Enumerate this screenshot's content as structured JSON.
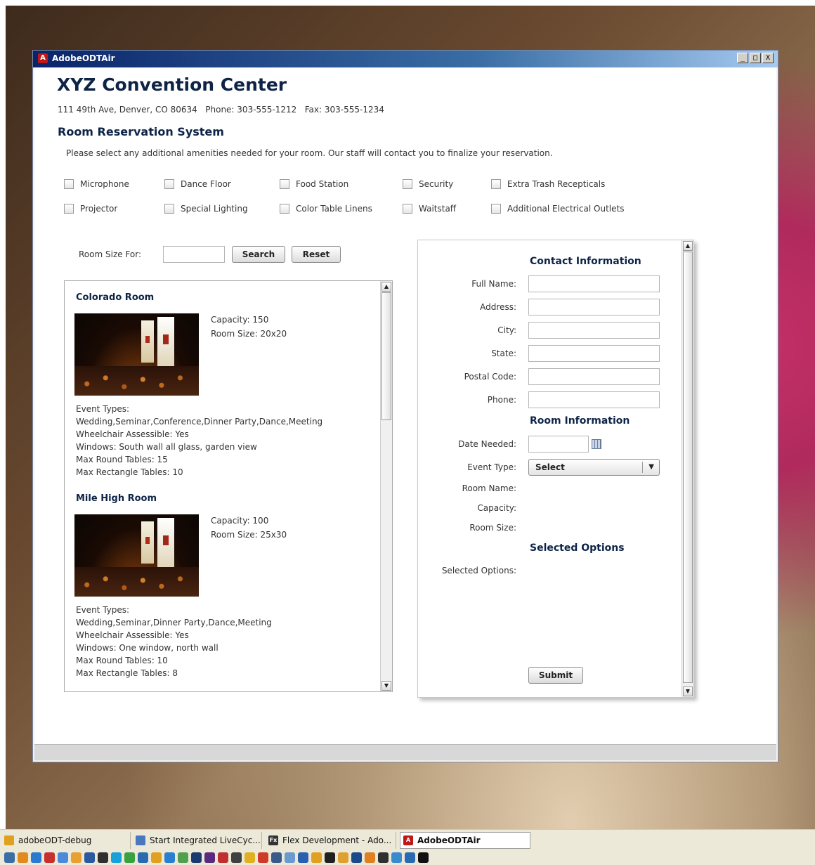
{
  "window": {
    "title": "AdobeODTAir",
    "minimize": "_",
    "maximize": "□",
    "close": "X"
  },
  "header": {
    "title": "XYZ Convention Center",
    "address": "111 49th Ave, Denver, CO 80634   Phone: 303-555-1212   Fax: 303-555-1234",
    "subtitle": "Room Reservation System",
    "intro": "Please select any additional amenities needed for your room. Our staff will contact you to finalize your reservation."
  },
  "amenities": [
    {
      "label": "Microphone",
      "checked": false
    },
    {
      "label": "Dance Floor",
      "checked": false
    },
    {
      "label": "Food Station",
      "checked": false
    },
    {
      "label": "Security",
      "checked": false
    },
    {
      "label": "Extra Trash Recepticals",
      "checked": false
    },
    {
      "label": "Projector",
      "checked": false
    },
    {
      "label": "Special Lighting",
      "checked": false
    },
    {
      "label": "Color Table Linens",
      "checked": false
    },
    {
      "label": "Waitstaff",
      "checked": false
    },
    {
      "label": "Additional Electrical Outlets",
      "checked": false
    }
  ],
  "search": {
    "label": "Room Size For:",
    "value": "",
    "search_button": "Search",
    "reset_button": "Reset"
  },
  "rooms": [
    {
      "name": "Colorado Room",
      "capacity": "Capacity: 150",
      "size": "Room Size: 20x20",
      "details": [
        "Event Types:",
        "Wedding,Seminar,Conference,Dinner Party,Dance,Meeting",
        "Wheelchair Assessible: Yes",
        "Windows: South wall all glass, garden view",
        "Max Round Tables: 15",
        "Max Rectangle Tables: 10"
      ]
    },
    {
      "name": "Mile High Room",
      "capacity": "Capacity: 100",
      "size": "Room Size: 25x30",
      "details": [
        "Event Types:",
        "Wedding,Seminar,Dinner Party,Dance,Meeting",
        "Wheelchair Assessible: Yes",
        "Windows: One window, north wall",
        "Max Round Tables: 10",
        "Max Rectangle Tables: 8"
      ]
    }
  ],
  "form": {
    "contact_heading": "Contact Information",
    "full_name_label": "Full Name:",
    "address_label": "Address:",
    "city_label": "City:",
    "state_label": "State:",
    "postal_label": "Postal Code:",
    "phone_label": "Phone:",
    "room_heading": "Room Information",
    "date_label": "Date Needed:",
    "event_type_label": "Event Type:",
    "event_type_value": "Select",
    "room_name_label": "Room Name:",
    "capacity_label": "Capacity:",
    "room_size_label": "Room Size:",
    "options_heading": "Selected Options",
    "selected_options_label": "Selected Options:",
    "submit_button": "Submit"
  },
  "taskbar": {
    "tasks": [
      {
        "label": "adobeODT-debug",
        "icon": "folder-icon",
        "color": "#e0a020"
      },
      {
        "label": "Start Integrated LiveCyc...",
        "icon": "livecycle-icon",
        "color": "#4a78c0"
      },
      {
        "label": "Flex Development - Ado...",
        "icon": "flex-icon",
        "color": "#333333"
      },
      {
        "label": "AdobeODTAir",
        "icon": "air-icon",
        "color": "#c01818"
      }
    ],
    "quick_launch_count": 36
  }
}
